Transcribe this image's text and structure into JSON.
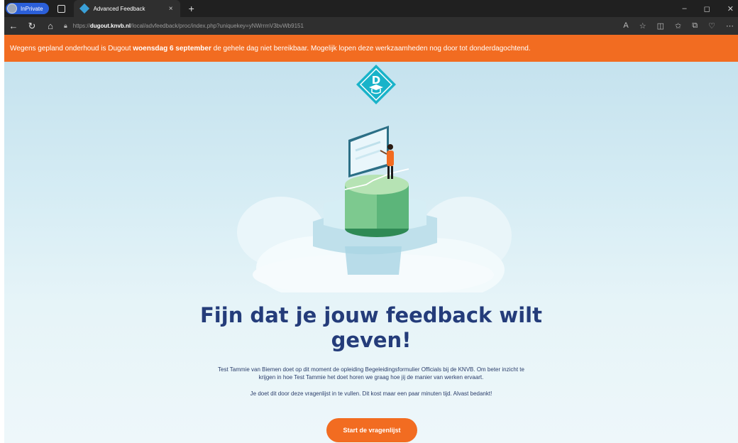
{
  "browser": {
    "inprivate_label": "InPrivate",
    "tab_title": "Advanced Feedback",
    "tab_close": "×",
    "new_tab": "+",
    "url_scheme": "https://",
    "url_host": "dugout.knvb.nl",
    "url_path": "/local/advfeedback/proc/index.php?uniquekey=yNWrrmV3bvWb9151",
    "window_controls": [
      "–",
      "◻",
      "✕"
    ]
  },
  "banner": {
    "text_before": "Wegens gepland onderhoud is Dugout ",
    "text_bold": "woensdag 6 september",
    "text_after": " de gehele dag niet bereikbaar. Mogelijk lopen deze werkzaamheden nog door tot donderdagochtend."
  },
  "logo": {
    "letter": "D"
  },
  "main": {
    "headline_line1": "Fijn dat je jouw feedback wilt",
    "headline_line2": "geven!",
    "intro": "Test Tammie van Biemen doet op dit moment de opleiding Begeleidingsformulier Officials bij de KNVB. Om beter inzicht te krijgen in hoe Test Tammie het doet horen we graag hoe jij de manier van werken ervaart.",
    "intro2": "Je doet dit door deze vragenlijst in te vullen. Dit kost maar een paar minuten tijd. Alvast bedankt!",
    "start_button": "Start de vragenlijst"
  },
  "colors": {
    "accent": "#f26c21",
    "heading": "#243c7a",
    "logo": "#19b3c9"
  }
}
